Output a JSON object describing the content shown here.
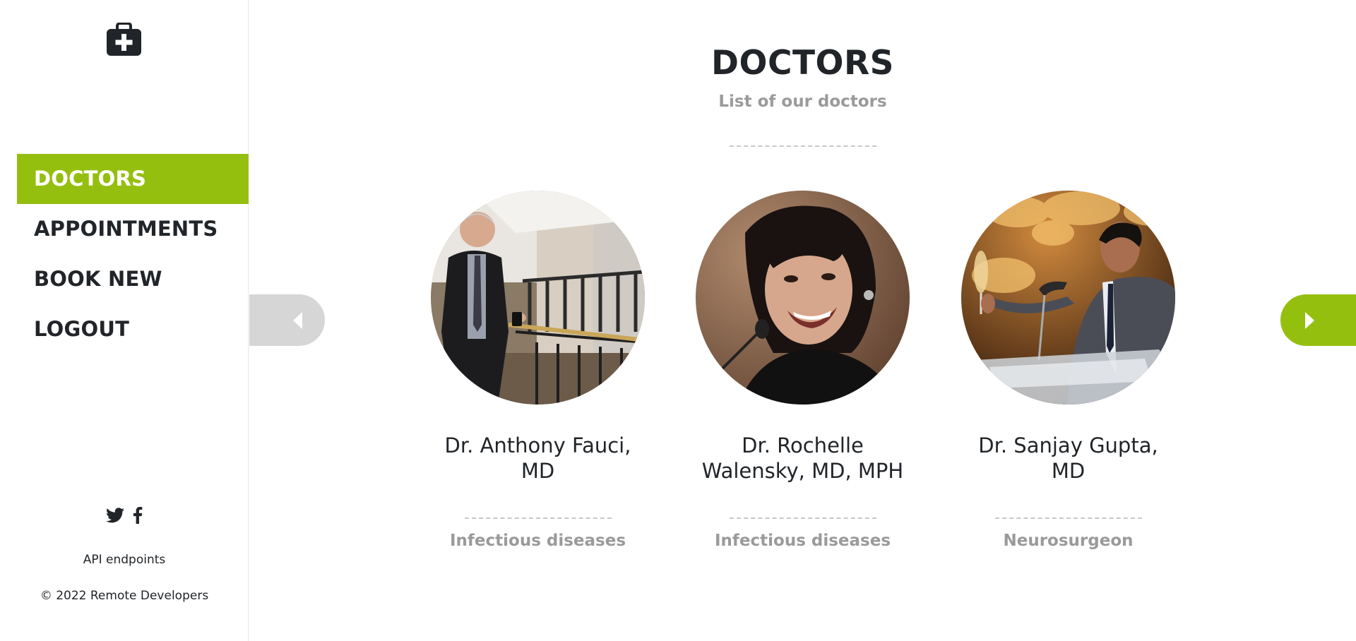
{
  "brand": {
    "logo_icon": "medkit-icon"
  },
  "sidebar": {
    "items": [
      {
        "label": "DOCTORS",
        "active": true
      },
      {
        "label": "APPOINTMENTS",
        "active": false
      },
      {
        "label": "BOOK NEW",
        "active": false
      },
      {
        "label": "LOGOUT",
        "active": false
      }
    ],
    "social_icons": [
      "twitter-icon",
      "facebook-icon"
    ],
    "api_link": "API endpoints",
    "copyright": "© 2022 Remote Developers"
  },
  "main": {
    "title": "DOCTORS",
    "subtitle": "List of our doctors",
    "carousel": {
      "prev_icon": "caret-left-icon",
      "next_icon": "caret-right-icon",
      "doctors": [
        {
          "name": "Dr. Anthony Fauci, MD",
          "specialty": "Infectious diseases"
        },
        {
          "name": "Dr. Rochelle Walensky, MD, MPH",
          "specialty": "Infectious diseases"
        },
        {
          "name": "Dr. Sanjay Gupta, MD",
          "specialty": "Neurosurgeon"
        }
      ]
    }
  },
  "colors": {
    "accent": "#95bf0e",
    "text": "#212529",
    "muted": "#9a9a9a",
    "arrow_inactive": "#d6d6d6"
  }
}
